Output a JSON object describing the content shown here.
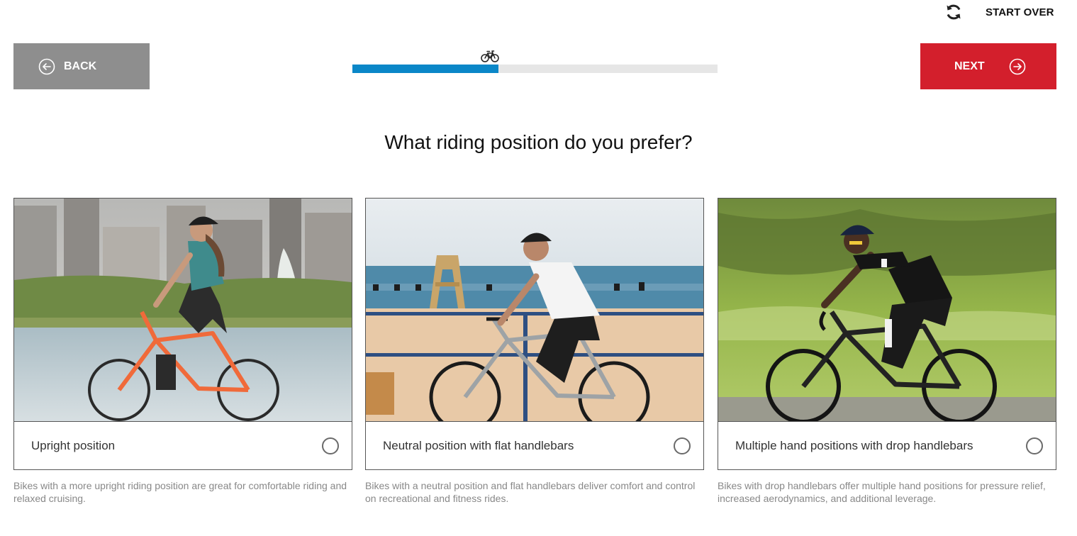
{
  "header": {
    "start_over_label": "START OVER",
    "start_over_icon": "refresh-icon"
  },
  "nav": {
    "back_label": "BACK",
    "back_icon": "arrow-left-circle-icon",
    "next_label": "NEXT",
    "next_icon": "arrow-right-circle-icon"
  },
  "progress": {
    "fraction": 0.4,
    "marker_icon": "bicycle-icon"
  },
  "question": "What riding position do you prefer?",
  "options": [
    {
      "label": "Upright position",
      "selected": false,
      "image_description_icon": "upright-bike-photo",
      "description": "Bikes with a more upright riding position are great for comfortable riding and relaxed cruising."
    },
    {
      "label": "Neutral position with flat handlebars",
      "selected": false,
      "image_description_icon": "flat-bar-bike-photo",
      "description": "Bikes with a neutral position and flat handlebars deliver comfort and control on recreational and fitness rides."
    },
    {
      "label": "Multiple hand positions with drop handlebars",
      "selected": false,
      "image_description_icon": "drop-bar-bike-photo",
      "description": "Bikes with drop handlebars offer multiple hand positions for pressure relief, increased aerodynamics, and additional leverage."
    }
  ],
  "colors": {
    "back_button": "#8e8e8e",
    "next_button": "#d31f2c",
    "progress_fill": "#0a87c8",
    "progress_track": "#e6e6e6"
  }
}
